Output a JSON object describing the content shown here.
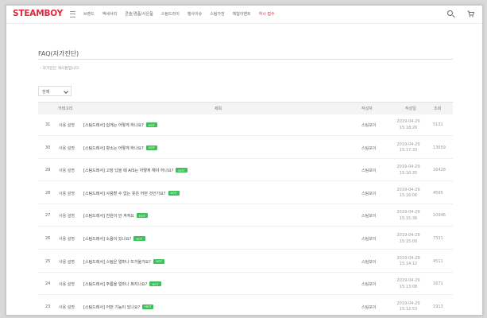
{
  "header": {
    "logo": "STEAMBOY",
    "nav": [
      "브랜드",
      "액세서리",
      "콘솔/경품/사은품",
      "스팀드라이",
      "행사이슈",
      "스팀가전",
      "체험이벤트",
      "하시 접수"
    ],
    "nav_highlight_index": 7,
    "accent_color": "#e0283c"
  },
  "page": {
    "title": "FAQ(자가진단)",
    "notice": "› 자가진단 게시판입니다.",
    "filter_value": "전체"
  },
  "table": {
    "headers": {
      "category": "카테고리",
      "subject": "제목",
      "author": "작성자",
      "date": "작성일",
      "views": "조회"
    },
    "badge_label": "HOT",
    "rows": [
      {
        "no": "31",
        "category": "사용 설명",
        "subject": "[스팀드레서] 쉽게는 어떻게 하나요?",
        "author": "스팀보이",
        "date": "2019-04-29",
        "time": "15:18:26",
        "views": "5131"
      },
      {
        "no": "30",
        "category": "사용 설명",
        "subject": "[스팀드레서] 향소는 어떻게 하나요?",
        "author": "스팀보이",
        "date": "2019-04-29",
        "time": "15:17:33",
        "views": "13659"
      },
      {
        "no": "29",
        "category": "사용 설명",
        "subject": "[스팀드레서] 고장 났을 때 A/S는 어떻게 해야 하나요?",
        "author": "스팀보이",
        "date": "2019-04-29",
        "time": "15:16:35",
        "views": "16428"
      },
      {
        "no": "28",
        "category": "사용 설명",
        "subject": "[스팀드레서] 사용할 수 없는 옷은 어떤 것인가요?",
        "author": "스팀보이",
        "date": "2019-04-29",
        "time": "15:16:06",
        "views": "4595"
      },
      {
        "no": "27",
        "category": "사용 설명",
        "subject": "[스팀드레서] 전원이 안 켜져요",
        "author": "스팀보이",
        "date": "2019-04-29",
        "time": "15:15:36",
        "views": "10946"
      },
      {
        "no": "26",
        "category": "사용 설명",
        "subject": "[스팀드레서] 소음이 있나요?",
        "author": "스팀보이",
        "date": "2019-04-29",
        "time": "15:15:00",
        "views": "7331"
      },
      {
        "no": "25",
        "category": "사용 설명",
        "subject": "[스팀드레서] 스팀은 얼마나 뜨거울가요?",
        "author": "스팀보이",
        "date": "2019-04-29",
        "time": "15:14:12",
        "views": "4511"
      },
      {
        "no": "24",
        "category": "사용 설명",
        "subject": "[스팀드레서] 주름을 얼마나 펴지나요?",
        "author": "스팀보이",
        "date": "2019-04-29",
        "time": "15:13:08",
        "views": "1671"
      },
      {
        "no": "23",
        "category": "사용 설명",
        "subject": "[스팀드레서] 어떤 기능이 있나요?",
        "author": "스팀보이",
        "date": "2019-04-29",
        "time": "15:12:53",
        "views": "1913"
      }
    ]
  }
}
